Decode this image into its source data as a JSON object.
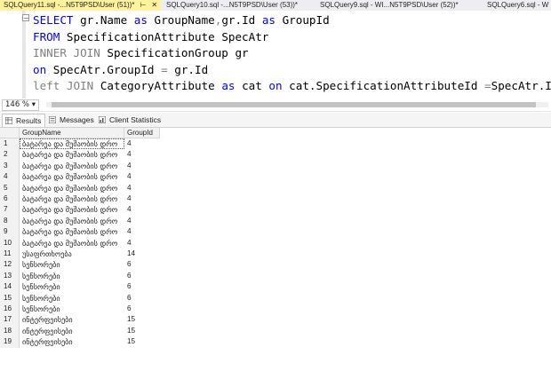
{
  "tabs": [
    {
      "label": "SQLQuery11.sql -...N5T9PSD\\User (51))*",
      "active": true
    },
    {
      "label": "SQLQuery10.sql -...N5T9PSD\\User (53))*",
      "active": false
    },
    {
      "label": "SQLQuery9.sql - WI...N5T9PSD\\User (52))*",
      "active": false
    },
    {
      "label": "SQLQuery6.sql - W",
      "active": false
    }
  ],
  "editor": {
    "lines": [
      [
        {
          "t": "SELECT",
          "c": "kw"
        },
        {
          "t": " gr.Name ",
          "c": ""
        },
        {
          "t": "as",
          "c": "kw"
        },
        {
          "t": " GroupName",
          "c": ""
        },
        {
          "t": ",",
          "c": "gray"
        },
        {
          "t": "gr.Id ",
          "c": ""
        },
        {
          "t": "as",
          "c": "kw"
        },
        {
          "t": " GroupId",
          "c": ""
        }
      ],
      [
        {
          "t": "FROM",
          "c": "kw"
        },
        {
          "t": " SpecificationAttribute SpecAtr",
          "c": ""
        }
      ],
      [
        {
          "t": "INNER JOIN",
          "c": "gray"
        },
        {
          "t": " SpecificationGroup gr",
          "c": ""
        }
      ],
      [
        {
          "t": "on",
          "c": "kw"
        },
        {
          "t": " SpecAtr.GroupId ",
          "c": ""
        },
        {
          "t": "=",
          "c": "gray"
        },
        {
          "t": " gr.Id",
          "c": ""
        }
      ],
      [
        {
          "t": "left JOIN",
          "c": "gray"
        },
        {
          "t": " CategoryAttribute ",
          "c": ""
        },
        {
          "t": "as",
          "c": "kw"
        },
        {
          "t": " cat ",
          "c": ""
        },
        {
          "t": "on",
          "c": "kw"
        },
        {
          "t": " cat.SpecificationAttributeId ",
          "c": ""
        },
        {
          "t": "=",
          "c": "gray"
        },
        {
          "t": "SpecAtr.Id",
          "c": ""
        }
      ]
    ]
  },
  "zoom": "146 %",
  "result_tabs": [
    {
      "label": "Results",
      "active": true
    },
    {
      "label": "Messages",
      "active": false
    },
    {
      "label": "Client Statistics",
      "active": false
    }
  ],
  "grid": {
    "columns": [
      "GroupName",
      "GroupId"
    ],
    "rows": [
      [
        "1",
        "ბატარეა და მუშაობის დრო",
        "4"
      ],
      [
        "2",
        "ბატარეა და მუშაობის დრო",
        "4"
      ],
      [
        "3",
        "ბატარეა და მუშაობის დრო",
        "4"
      ],
      [
        "4",
        "ბატარეა და მუშაობის დრო",
        "4"
      ],
      [
        "5",
        "ბატარეა და მუშაობის დრო",
        "4"
      ],
      [
        "6",
        "ბატარეა და მუშაობის დრო",
        "4"
      ],
      [
        "7",
        "ბატარეა და მუშაობის დრო",
        "4"
      ],
      [
        "8",
        "ბატარეა და მუშაობის დრო",
        "4"
      ],
      [
        "9",
        "ბატარეა და მუშაობის დრო",
        "4"
      ],
      [
        "10",
        "ბატარეა და მუშაობის დრო",
        "4"
      ],
      [
        "11",
        "უსაფრთხოება",
        "14"
      ],
      [
        "12",
        "სენსორები",
        "6"
      ],
      [
        "13",
        "სენსორები",
        "6"
      ],
      [
        "14",
        "სენსორები",
        "6"
      ],
      [
        "15",
        "სენსორები",
        "6"
      ],
      [
        "16",
        "სენსორები",
        "6"
      ],
      [
        "17",
        "ინტერფეისები",
        "15"
      ],
      [
        "18",
        "ინტერფეისები",
        "15"
      ],
      [
        "19",
        "ინტერფეისები",
        "15"
      ]
    ]
  }
}
